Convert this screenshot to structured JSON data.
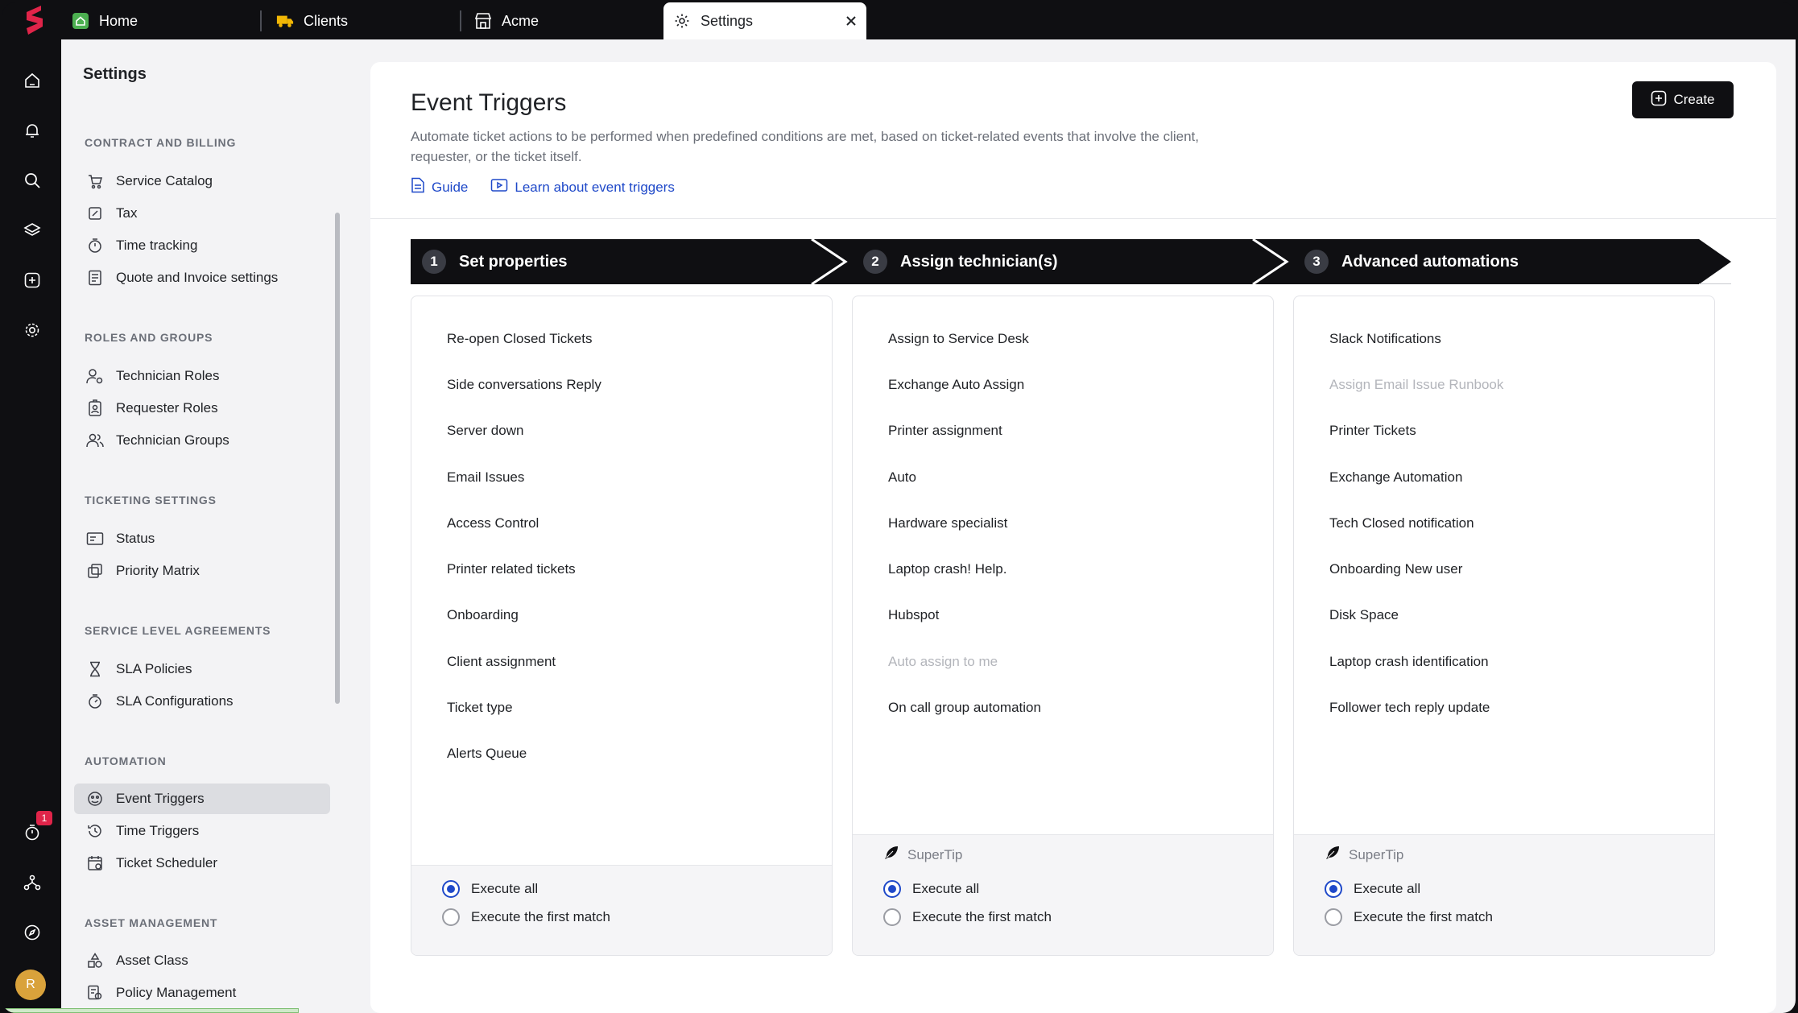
{
  "tabs": [
    {
      "label": "Home",
      "icon": "home-icon"
    },
    {
      "label": "Clients",
      "icon": "truck-icon"
    },
    {
      "label": "Acme",
      "icon": "store-icon"
    },
    {
      "label": "Settings",
      "icon": "gear-icon"
    }
  ],
  "rail": {
    "icons": [
      "home-icon",
      "bell-icon",
      "search-icon",
      "layers-icon",
      "plus-square-icon",
      "gear-icon",
      "timer-icon",
      "network-icon",
      "compass-icon"
    ],
    "badge_count": "1",
    "avatar_initial": "R"
  },
  "sidebar": {
    "title": "Settings",
    "sections": [
      {
        "label": "CONTRACT AND BILLING",
        "items": [
          {
            "label": "Service Catalog",
            "icon": "cart-icon"
          },
          {
            "label": "Tax",
            "icon": "percent-icon"
          },
          {
            "label": "Time tracking",
            "icon": "stopwatch-icon"
          },
          {
            "label": "Quote and Invoice settings",
            "icon": "invoice-icon"
          }
        ]
      },
      {
        "label": "ROLES AND GROUPS",
        "items": [
          {
            "label": "Technician Roles",
            "icon": "user-gear-icon"
          },
          {
            "label": "Requester Roles",
            "icon": "id-badge-icon"
          },
          {
            "label": "Technician Groups",
            "icon": "users-icon"
          }
        ]
      },
      {
        "label": "TICKETING SETTINGS",
        "items": [
          {
            "label": "Status",
            "icon": "ticket-icon"
          },
          {
            "label": "Priority Matrix",
            "icon": "matrix-icon"
          }
        ]
      },
      {
        "label": "SERVICE LEVEL AGREEMENTS",
        "items": [
          {
            "label": "SLA Policies",
            "icon": "hourglass-icon"
          },
          {
            "label": "SLA Configurations",
            "icon": "stopwatch-icon"
          }
        ]
      },
      {
        "label": "AUTOMATION",
        "items": [
          {
            "label": "Event Triggers",
            "icon": "event-icon",
            "selected": true
          },
          {
            "label": "Time Triggers",
            "icon": "clock-history-icon"
          },
          {
            "label": "Ticket Scheduler",
            "icon": "calendar-icon"
          }
        ]
      },
      {
        "label": "ASSET MANAGEMENT",
        "items": [
          {
            "label": "Asset Class",
            "icon": "shapes-icon"
          },
          {
            "label": "Policy Management",
            "icon": "policy-icon"
          }
        ]
      }
    ]
  },
  "content": {
    "title": "Event Triggers",
    "description": "Automate ticket actions to be performed when predefined conditions are met, based on ticket-related events that involve the client, requester, or the ticket itself.",
    "guide_link": "Guide",
    "learn_link": "Learn about event triggers",
    "create_label": "Create",
    "steps": [
      {
        "num": "1",
        "label": "Set properties"
      },
      {
        "num": "2",
        "label": "Assign technician(s)"
      },
      {
        "num": "3",
        "label": "Advanced automations"
      }
    ],
    "columns": [
      {
        "items": [
          {
            "label": "Re-open Closed Tickets"
          },
          {
            "label": "Side conversations Reply"
          },
          {
            "label": "Server down"
          },
          {
            "label": "Email Issues"
          },
          {
            "label": "Access Control"
          },
          {
            "label": "Printer related tickets"
          },
          {
            "label": "Onboarding"
          },
          {
            "label": "Client assignment"
          },
          {
            "label": "Ticket type"
          },
          {
            "label": "Alerts Queue"
          }
        ],
        "tip": "",
        "execute_all": "Execute all",
        "execute_first": "Execute the first match",
        "selected": "all"
      },
      {
        "items": [
          {
            "label": "Assign to Service Desk"
          },
          {
            "label": "Exchange Auto Assign"
          },
          {
            "label": "Printer assignment"
          },
          {
            "label": "Auto"
          },
          {
            "label": "Hardware specialist"
          },
          {
            "label": "Laptop crash! Help."
          },
          {
            "label": "Hubspot"
          },
          {
            "label": "Auto assign to me",
            "disabled": true
          },
          {
            "label": "On call group automation"
          }
        ],
        "tip": "SuperTip",
        "execute_all": "Execute all",
        "execute_first": "Execute the first match",
        "selected": "all"
      },
      {
        "items": [
          {
            "label": "Slack Notifications"
          },
          {
            "label": "Assign Email Issue Runbook",
            "disabled": true
          },
          {
            "label": "Printer Tickets"
          },
          {
            "label": "Exchange Automation"
          },
          {
            "label": "Tech Closed notification"
          },
          {
            "label": "Onboarding New user"
          },
          {
            "label": "Disk Space"
          },
          {
            "label": "Laptop crash identification"
          },
          {
            "label": "Follower tech reply update"
          }
        ],
        "tip": "SuperTip",
        "execute_all": "Execute all",
        "execute_first": "Execute the first match",
        "selected": "all"
      }
    ]
  },
  "colors": {
    "accent": "#1f49c9",
    "dark": "#0f0f12",
    "brand": "#e02449"
  }
}
